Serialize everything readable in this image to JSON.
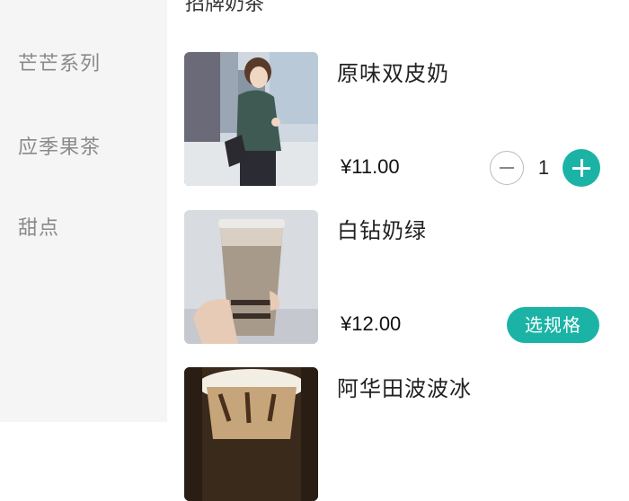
{
  "sidebar": {
    "items": [
      {
        "label": "芒芒系列"
      },
      {
        "label": "应季果茶"
      },
      {
        "label": "甜点"
      }
    ]
  },
  "main": {
    "section_title": "招牌奶茶",
    "products": [
      {
        "name": "原味双皮奶",
        "price": "¥11.00",
        "quantity": "1"
      },
      {
        "name": "白钻奶绿",
        "price": "¥12.00",
        "spec_label": "选规格"
      },
      {
        "name": "阿华田波波冰"
      }
    ]
  },
  "colors": {
    "accent": "#1bb3a5",
    "sidebar_bg": "#f5f5f5",
    "sidebar_text": "#8a8a8a"
  },
  "icons": [
    "minus-icon",
    "plus-icon"
  ]
}
